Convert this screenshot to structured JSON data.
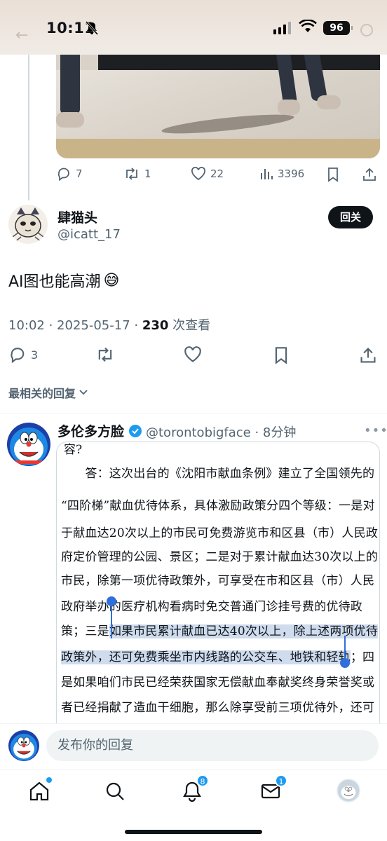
{
  "status_bar": {
    "time": "10:11",
    "battery": "96"
  },
  "previous_tweet": {
    "actions": {
      "replies": "7",
      "reposts": "1",
      "likes": "22",
      "views": "3396"
    }
  },
  "main_tweet": {
    "display_name": "肆猫头",
    "handle": "@icatt_17",
    "follow_button": "回关",
    "text": "AI图也能高潮",
    "emoji": "😅",
    "timestamp": "10:02 · 2025-05-17 · ",
    "view_count": "230",
    "view_label": " 次查看",
    "reply_count": "3",
    "replies_sort_label": "最相关的回复"
  },
  "reply": {
    "display_name": "多伦多方脸",
    "handle_time": "@torontobigface · 8分钟",
    "doc_fragment": "容?",
    "doc_lines": {
      "l1": "　　答：这次出台的《沈阳市献血条例》建立了全国领先的",
      "l2": "“四阶梯”献血优待体系，具体激励政策分四个等级：一是对",
      "l3": "于献血达20次以上的市民可免费游览市和区县（市）人民政",
      "l4": "府定价管理的公园、景区；二是对于累计献血达30次以上的",
      "l5": "市民，除第一项优待政策外，可享受在市和区县（市）人民",
      "l6": "政府举办的医疗机构看病时免交普通门诊挂号费的优待政",
      "l7a": "策；三是",
      "l7b": "如果市民累计献血已达40次以上，除上述两项优待",
      "l8a": "政策外，还可免费乘坐市内线路的公交车、地铁和轻轨",
      "l8b": "；四",
      "l9": "是如果咱们市民已经荣获国家无偿献血奉献奖终身荣誉奖或",
      "l10": "者已经捐献了造血干细胞，那么除享受前三项优待外，还可"
    }
  },
  "composer": {
    "placeholder": "发布你的回复"
  },
  "nav": {
    "notifications_badge": "8",
    "messages_badge": "1"
  },
  "colors": {
    "accent": "#1d9bf0",
    "selection": "#cfdcee",
    "selection_handle": "#2f6fdc",
    "verified": "#1d9bf0"
  },
  "icons": [
    "back-arrow-icon",
    "mute-bell-icon",
    "signal-icon",
    "wifi-icon",
    "battery-icon",
    "reply-icon",
    "repost-icon",
    "like-icon",
    "views-icon",
    "bookmark-icon",
    "share-icon",
    "chevron-down-icon",
    "verified-icon",
    "more-icon",
    "home-icon",
    "search-icon",
    "notifications-icon",
    "messages-icon",
    "profile-icon"
  ]
}
